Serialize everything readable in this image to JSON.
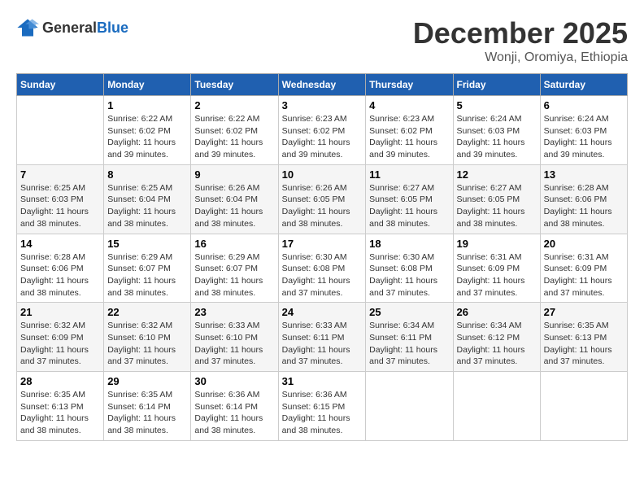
{
  "logo": {
    "text_general": "General",
    "text_blue": "Blue"
  },
  "title": {
    "month": "December 2025",
    "location": "Wonji, Oromiya, Ethiopia"
  },
  "headers": [
    "Sunday",
    "Monday",
    "Tuesday",
    "Wednesday",
    "Thursday",
    "Friday",
    "Saturday"
  ],
  "weeks": [
    [
      {
        "day": "",
        "info": ""
      },
      {
        "day": "1",
        "info": "Sunrise: 6:22 AM\nSunset: 6:02 PM\nDaylight: 11 hours\nand 39 minutes."
      },
      {
        "day": "2",
        "info": "Sunrise: 6:22 AM\nSunset: 6:02 PM\nDaylight: 11 hours\nand 39 minutes."
      },
      {
        "day": "3",
        "info": "Sunrise: 6:23 AM\nSunset: 6:02 PM\nDaylight: 11 hours\nand 39 minutes."
      },
      {
        "day": "4",
        "info": "Sunrise: 6:23 AM\nSunset: 6:02 PM\nDaylight: 11 hours\nand 39 minutes."
      },
      {
        "day": "5",
        "info": "Sunrise: 6:24 AM\nSunset: 6:03 PM\nDaylight: 11 hours\nand 39 minutes."
      },
      {
        "day": "6",
        "info": "Sunrise: 6:24 AM\nSunset: 6:03 PM\nDaylight: 11 hours\nand 39 minutes."
      }
    ],
    [
      {
        "day": "7",
        "info": "Sunrise: 6:25 AM\nSunset: 6:03 PM\nDaylight: 11 hours\nand 38 minutes."
      },
      {
        "day": "8",
        "info": "Sunrise: 6:25 AM\nSunset: 6:04 PM\nDaylight: 11 hours\nand 38 minutes."
      },
      {
        "day": "9",
        "info": "Sunrise: 6:26 AM\nSunset: 6:04 PM\nDaylight: 11 hours\nand 38 minutes."
      },
      {
        "day": "10",
        "info": "Sunrise: 6:26 AM\nSunset: 6:05 PM\nDaylight: 11 hours\nand 38 minutes."
      },
      {
        "day": "11",
        "info": "Sunrise: 6:27 AM\nSunset: 6:05 PM\nDaylight: 11 hours\nand 38 minutes."
      },
      {
        "day": "12",
        "info": "Sunrise: 6:27 AM\nSunset: 6:05 PM\nDaylight: 11 hours\nand 38 minutes."
      },
      {
        "day": "13",
        "info": "Sunrise: 6:28 AM\nSunset: 6:06 PM\nDaylight: 11 hours\nand 38 minutes."
      }
    ],
    [
      {
        "day": "14",
        "info": "Sunrise: 6:28 AM\nSunset: 6:06 PM\nDaylight: 11 hours\nand 38 minutes."
      },
      {
        "day": "15",
        "info": "Sunrise: 6:29 AM\nSunset: 6:07 PM\nDaylight: 11 hours\nand 38 minutes."
      },
      {
        "day": "16",
        "info": "Sunrise: 6:29 AM\nSunset: 6:07 PM\nDaylight: 11 hours\nand 38 minutes."
      },
      {
        "day": "17",
        "info": "Sunrise: 6:30 AM\nSunset: 6:08 PM\nDaylight: 11 hours\nand 37 minutes."
      },
      {
        "day": "18",
        "info": "Sunrise: 6:30 AM\nSunset: 6:08 PM\nDaylight: 11 hours\nand 37 minutes."
      },
      {
        "day": "19",
        "info": "Sunrise: 6:31 AM\nSunset: 6:09 PM\nDaylight: 11 hours\nand 37 minutes."
      },
      {
        "day": "20",
        "info": "Sunrise: 6:31 AM\nSunset: 6:09 PM\nDaylight: 11 hours\nand 37 minutes."
      }
    ],
    [
      {
        "day": "21",
        "info": "Sunrise: 6:32 AM\nSunset: 6:09 PM\nDaylight: 11 hours\nand 37 minutes."
      },
      {
        "day": "22",
        "info": "Sunrise: 6:32 AM\nSunset: 6:10 PM\nDaylight: 11 hours\nand 37 minutes."
      },
      {
        "day": "23",
        "info": "Sunrise: 6:33 AM\nSunset: 6:10 PM\nDaylight: 11 hours\nand 37 minutes."
      },
      {
        "day": "24",
        "info": "Sunrise: 6:33 AM\nSunset: 6:11 PM\nDaylight: 11 hours\nand 37 minutes."
      },
      {
        "day": "25",
        "info": "Sunrise: 6:34 AM\nSunset: 6:11 PM\nDaylight: 11 hours\nand 37 minutes."
      },
      {
        "day": "26",
        "info": "Sunrise: 6:34 AM\nSunset: 6:12 PM\nDaylight: 11 hours\nand 37 minutes."
      },
      {
        "day": "27",
        "info": "Sunrise: 6:35 AM\nSunset: 6:13 PM\nDaylight: 11 hours\nand 37 minutes."
      }
    ],
    [
      {
        "day": "28",
        "info": "Sunrise: 6:35 AM\nSunset: 6:13 PM\nDaylight: 11 hours\nand 38 minutes."
      },
      {
        "day": "29",
        "info": "Sunrise: 6:35 AM\nSunset: 6:14 PM\nDaylight: 11 hours\nand 38 minutes."
      },
      {
        "day": "30",
        "info": "Sunrise: 6:36 AM\nSunset: 6:14 PM\nDaylight: 11 hours\nand 38 minutes."
      },
      {
        "day": "31",
        "info": "Sunrise: 6:36 AM\nSunset: 6:15 PM\nDaylight: 11 hours\nand 38 minutes."
      },
      {
        "day": "",
        "info": ""
      },
      {
        "day": "",
        "info": ""
      },
      {
        "day": "",
        "info": ""
      }
    ]
  ]
}
